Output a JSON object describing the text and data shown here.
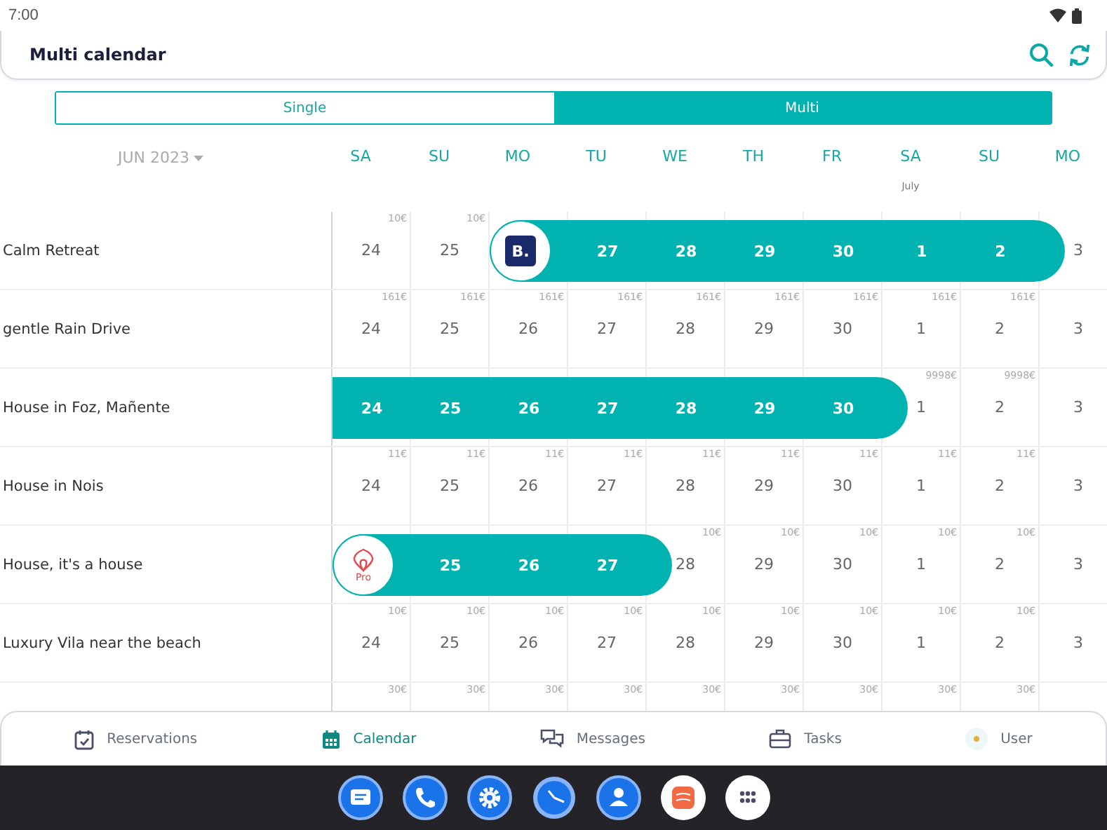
{
  "status_bar": {
    "time": "7:00"
  },
  "header": {
    "title": "Multi calendar"
  },
  "view_toggle": [
    {
      "label": "Single",
      "selected": false
    },
    {
      "label": "Multi",
      "selected": true
    }
  ],
  "calendar": {
    "month": "JUN 2023",
    "weekdays": [
      {
        "label": "SA"
      },
      {
        "label": "SU"
      },
      {
        "label": "MO"
      },
      {
        "label": "TU"
      },
      {
        "label": "WE"
      },
      {
        "label": "TH"
      },
      {
        "label": "FR"
      },
      {
        "label": "SA",
        "month": "July"
      },
      {
        "label": "SU"
      },
      {
        "label": "MO"
      }
    ],
    "rows": [
      {
        "name": "Calm Retreat",
        "booking": {
          "kind": "booking",
          "logo_text": "B."
        },
        "cells": [
          {
            "day": "24",
            "price": "10€"
          },
          {
            "day": "25",
            "price": "10€"
          },
          {
            "booked": true
          },
          {
            "day": "27",
            "booked": true
          },
          {
            "day": "28",
            "booked": true
          },
          {
            "day": "29",
            "booked": true
          },
          {
            "day": "30",
            "booked": true
          },
          {
            "day": "1",
            "booked": true
          },
          {
            "day": "2",
            "booked": true
          },
          {
            "day": "3"
          }
        ]
      },
      {
        "name": "gentle Rain Drive",
        "cells": [
          {
            "day": "24",
            "price": "161€"
          },
          {
            "day": "25",
            "price": "161€"
          },
          {
            "day": "26",
            "price": "161€"
          },
          {
            "day": "27",
            "price": "161€"
          },
          {
            "day": "28",
            "price": "161€"
          },
          {
            "day": "29",
            "price": "161€"
          },
          {
            "day": "30",
            "price": "161€"
          },
          {
            "day": "1",
            "price": "161€"
          },
          {
            "day": "2",
            "price": "161€"
          },
          {
            "day": "3"
          }
        ]
      },
      {
        "name": "House in Foz, Mañente",
        "booking": {
          "kind": "plain"
        },
        "cells": [
          {
            "day": "24",
            "booked": true
          },
          {
            "day": "25",
            "booked": true
          },
          {
            "day": "26",
            "booked": true
          },
          {
            "day": "27",
            "booked": true
          },
          {
            "day": "28",
            "booked": true
          },
          {
            "day": "29",
            "booked": true
          },
          {
            "day": "30",
            "booked": true
          },
          {
            "day": "1",
            "price": "9998€"
          },
          {
            "day": "2",
            "price": "9998€"
          },
          {
            "day": "3"
          }
        ]
      },
      {
        "name": "House in Nois",
        "cells": [
          {
            "day": "24",
            "price": "11€"
          },
          {
            "day": "25",
            "price": "11€"
          },
          {
            "day": "26",
            "price": "11€"
          },
          {
            "day": "27",
            "price": "11€"
          },
          {
            "day": "28",
            "price": "11€"
          },
          {
            "day": "29",
            "price": "11€"
          },
          {
            "day": "30",
            "price": "11€"
          },
          {
            "day": "1",
            "price": "11€"
          },
          {
            "day": "2",
            "price": "11€"
          },
          {
            "day": "3"
          }
        ]
      },
      {
        "name": "House, it's a house",
        "booking": {
          "kind": "airbnb",
          "logo_text": "Pro"
        },
        "cells": [
          {
            "booked": true
          },
          {
            "day": "25",
            "booked": true
          },
          {
            "day": "26",
            "booked": true
          },
          {
            "day": "27",
            "booked": true
          },
          {
            "day": "28",
            "price": "10€"
          },
          {
            "day": "29",
            "price": "10€"
          },
          {
            "day": "30",
            "price": "10€"
          },
          {
            "day": "1",
            "price": "10€"
          },
          {
            "day": "2",
            "price": "10€"
          },
          {
            "day": "3"
          }
        ]
      },
      {
        "name": "Luxury Vila near the beach",
        "cells": [
          {
            "day": "24",
            "price": "10€"
          },
          {
            "day": "25",
            "price": "10€"
          },
          {
            "day": "26",
            "price": "10€"
          },
          {
            "day": "27",
            "price": "10€"
          },
          {
            "day": "28",
            "price": "10€"
          },
          {
            "day": "29",
            "price": "10€"
          },
          {
            "day": "30",
            "price": "10€"
          },
          {
            "day": "1",
            "price": "10€"
          },
          {
            "day": "2",
            "price": "10€"
          },
          {
            "day": "3"
          }
        ]
      },
      {
        "cells": [
          {
            "price": "30€"
          },
          {
            "price": "30€"
          },
          {
            "price": "30€"
          },
          {
            "price": "30€"
          },
          {
            "price": "30€"
          },
          {
            "price": "30€"
          },
          {
            "price": "30€"
          },
          {
            "price": "30€"
          },
          {
            "price": "30€"
          }
        ]
      }
    ]
  },
  "bottom_nav": [
    {
      "label": "Reservations",
      "selected": false
    },
    {
      "label": "Calendar",
      "selected": true
    },
    {
      "label": "Messages",
      "selected": false
    },
    {
      "label": "Tasks",
      "selected": false
    },
    {
      "label": "User",
      "selected": false
    }
  ],
  "dock": [
    {
      "kind": "messages"
    },
    {
      "kind": "phone"
    },
    {
      "kind": "settings"
    },
    {
      "kind": "clock"
    },
    {
      "kind": "contacts"
    },
    {
      "kind": "app"
    },
    {
      "kind": "apps"
    }
  ]
}
